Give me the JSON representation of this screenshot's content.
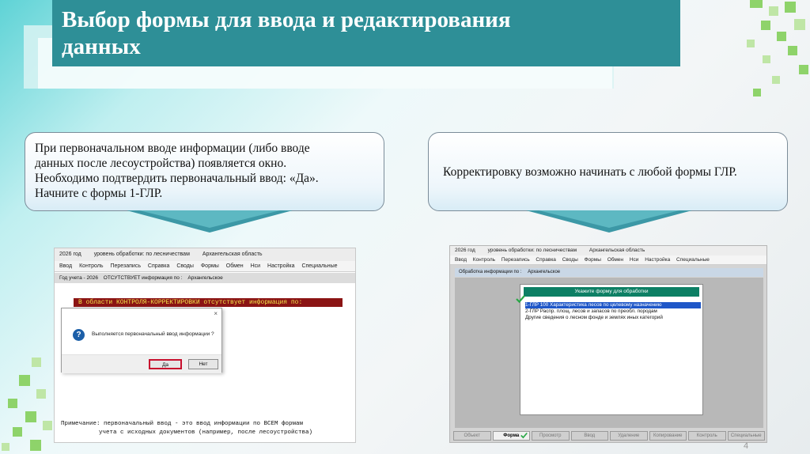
{
  "slide": {
    "title_line1": "Выбор формы для ввода и редактирования",
    "title_line2": "данных",
    "page_number": "4"
  },
  "callout_left": {
    "line1": "При первоначальном вводе информации (либо вводе",
    "line2": "данных после лесоустройства) появляется окно.",
    "line3": "Необходимо подтвердить первоначальный ввод: «Да».",
    "line4": "Начните с формы 1-ГЛР."
  },
  "callout_right": {
    "text": "Корректировку возможно начинать с любой  формы ГЛР."
  },
  "screenshot_left": {
    "top_bar": [
      "2026 год",
      "уровень обработки:   по лесничествам",
      "Архангельская область"
    ],
    "menu": [
      "Ввод",
      "Контроль",
      "Перезапись",
      "Справка",
      "Своды",
      "Формы",
      "Обмен",
      "Нси",
      "Настройка",
      "Специальные"
    ],
    "info_bar": [
      "Год учета - 2026",
      "ОТСУТСТВУЕТ информация по :",
      "Архангельское"
    ],
    "red_banner": "В области КОНТРОЛЯ-КОРРЕКТИРОВКИ отсутствует информация по:",
    "dialog": {
      "close": "×",
      "question_icon": "?",
      "text": "Выполняется первоначальный ввод информации ?",
      "yes": "Да",
      "no": "Нет"
    },
    "note_line1": "Примечание: первоначальный ввод - это ввод информации по ВСЕМ формам",
    "note_line2": "учета с исходных документов (например, после лесоустройства)"
  },
  "screenshot_right": {
    "top_bar": [
      "2026 год",
      "уровень обработки:   по лесничествам",
      "Архангельская область"
    ],
    "menu": [
      "Ввод",
      "Контроль",
      "Перезапись",
      "Справка",
      "Своды",
      "Формы",
      "Обмен",
      "Нси",
      "Настройка",
      "Специальные"
    ],
    "info_bar": [
      "Обработка информации по :",
      "Архангельское"
    ],
    "dialog_header": "Укажите форму для обработки",
    "items": [
      "1-ГЛР 100 Характеристика лесов по целевому назначению",
      "2-ГЛР Распр. площ. лесов и запасов по преобл. породам",
      "Другие сведения о лесном фонде и землях иных категорий"
    ],
    "bottom_buttons": [
      "Объект",
      "Форма",
      "Просмотр",
      "Ввод",
      "Удаление",
      "Копирование",
      "Контроль",
      "Специальные"
    ]
  },
  "colors": {
    "title_bg": "#2e8f97",
    "accent_green": "#8ed36a",
    "dialog_header_bg": "#0d7f64",
    "selection_bg": "#1f57c8",
    "banner_bg": "#8b1414",
    "banner_text": "#f2e24a"
  }
}
